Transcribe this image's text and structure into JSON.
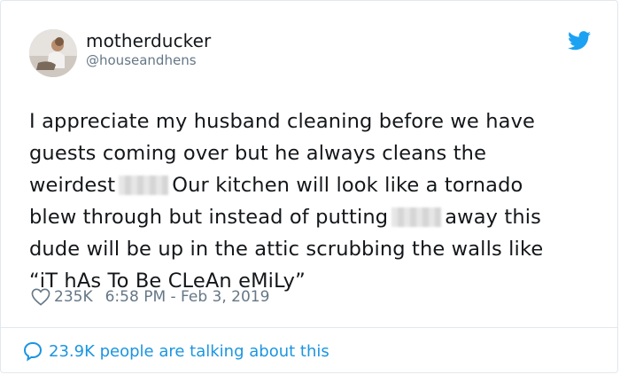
{
  "author": {
    "display_name": "motherducker",
    "handle": "@houseandhens"
  },
  "tweet": {
    "line1": "I appreciate my husband cleaning before we have",
    "line2": "guests coming over but he always cleans the",
    "line3a": "weirdest",
    "line3b": "Our kitchen will look like a tornado",
    "line4a": "blew through but instead of putting",
    "line4b": "away this",
    "line5": "dude will be up in the attic scrubbing the walls like",
    "line6": "“iT hAs To Be CLeAn eMiLy”"
  },
  "meta": {
    "likes": "235K",
    "timestamp": "6:58 PM - Feb 3, 2019"
  },
  "footer": {
    "talking": "23.9K people are talking about this"
  },
  "colors": {
    "twitter_blue": "#1da1f2",
    "link_blue": "#1b95e0",
    "secondary_text": "#657786"
  },
  "icons": {
    "brand": "twitter-bird-icon",
    "like": "heart-icon",
    "reply": "speech-bubble-icon"
  }
}
